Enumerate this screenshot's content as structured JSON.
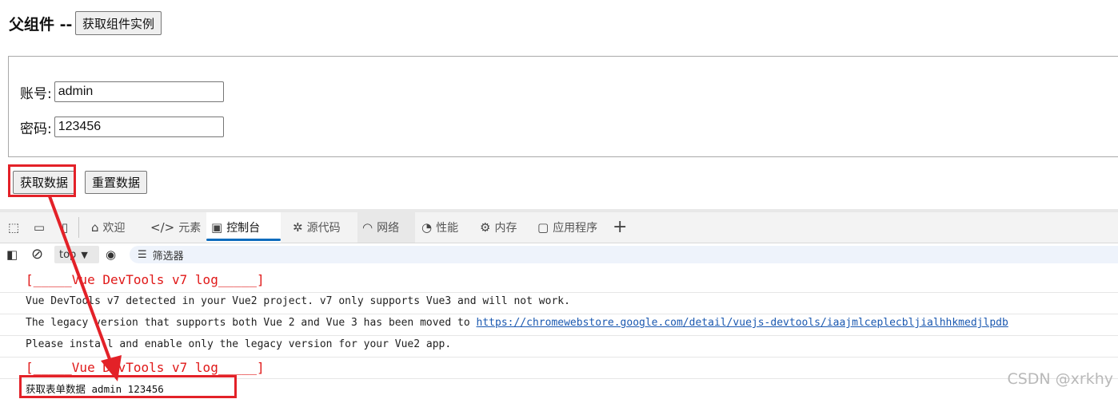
{
  "page": {
    "parent_title": "父组件 --",
    "get_instance_label": "获取组件实例",
    "account_label": "账号:",
    "account_value": "admin",
    "password_label": "密码:",
    "password_value": "123456",
    "get_data_label": "获取数据",
    "reset_data_label": "重置数据"
  },
  "devtools": {
    "tabs": [
      {
        "label": "欢迎",
        "icon": "home-icon"
      },
      {
        "label": "元素",
        "icon": "code-icon"
      },
      {
        "label": "控制台",
        "icon": "console-icon"
      },
      {
        "label": "源代码",
        "icon": "bug-icon"
      },
      {
        "label": "网络",
        "icon": "wifi-icon"
      },
      {
        "label": "性能",
        "icon": "performance-icon"
      },
      {
        "label": "内存",
        "icon": "chip-icon"
      },
      {
        "label": "应用程序",
        "icon": "app-icon"
      }
    ],
    "context": "top",
    "filter_label": "筛选器"
  },
  "console": {
    "banner_1": "[_____Vue DevTools v7 log_____]",
    "line_1": "Vue DevTools v7 detected in your Vue2 project. v7 only supports Vue3 and will not work.",
    "line_2_text": "The legacy version that supports both Vue 2 and Vue 3 has been moved to ",
    "line_2_link": " https://chromewebstore.google.com/detail/vuejs-devtools/iaajmlceplecbljialhhkmedjlpdb",
    "line_3": "Please install and enable only the legacy version for your Vue2 app.",
    "banner_2": "[_____Vue DevTools v7 log_____]",
    "line_4": "获取表单数据 admin 123456"
  },
  "watermark": "CSDN @xrkhy",
  "colors": {
    "highlight": "#e32128",
    "accent": "#0f6cbd",
    "banner": "#e01818"
  }
}
